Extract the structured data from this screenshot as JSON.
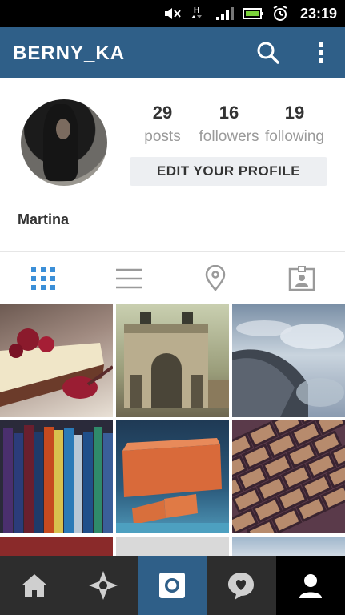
{
  "status_bar": {
    "time": "23:19",
    "icons": [
      "mute-icon",
      "hspa-signal-icon",
      "cell-signal-icon",
      "battery-icon",
      "alarm-icon"
    ]
  },
  "app_bar": {
    "title": "BERNY_KA",
    "icons": [
      "search-icon",
      "more-vert-icon"
    ],
    "color": "#2f5f88"
  },
  "profile": {
    "display_name": "Martina",
    "edit_button_label": "EDIT YOUR PROFILE",
    "stats": [
      {
        "value": "29",
        "label": "posts"
      },
      {
        "value": "16",
        "label": "followers"
      },
      {
        "value": "19",
        "label": "following"
      }
    ]
  },
  "view_tabs": [
    "grid-icon",
    "list-icon",
    "location-pin-icon",
    "tagged-photos-icon"
  ],
  "grid": {
    "photos": [
      "cheesecake",
      "arch",
      "airplane-window",
      "books",
      "brick-soap",
      "cobblestones"
    ]
  },
  "bottom_nav": {
    "items": [
      "home-icon",
      "explore-icon",
      "camera-icon",
      "activity-icon",
      "profile-icon"
    ],
    "active": "profile-icon"
  }
}
